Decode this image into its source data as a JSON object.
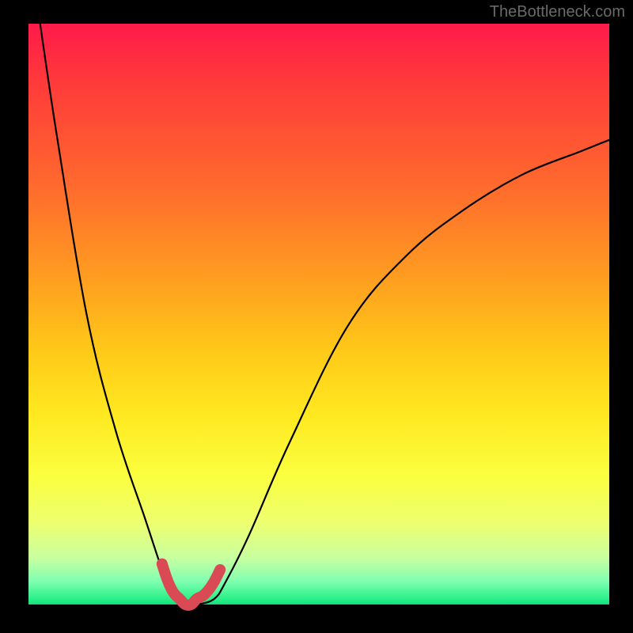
{
  "watermark": "TheBottleneck.com",
  "chart_data": {
    "type": "line",
    "title": "",
    "xlabel": "",
    "ylabel": "",
    "xlim": [
      0,
      100
    ],
    "ylim": [
      0,
      100
    ],
    "grid": false,
    "series": [
      {
        "name": "bottleneck-curve",
        "x": [
          2,
          5,
          10,
          15,
          20,
          23,
          25,
          27,
          29,
          32,
          34,
          38,
          45,
          55,
          65,
          75,
          85,
          95,
          100
        ],
        "y": [
          100,
          80,
          50,
          30,
          15,
          6,
          1,
          0,
          0,
          1,
          4,
          12,
          28,
          48,
          60,
          68,
          74,
          78,
          80
        ]
      }
    ],
    "highlight": {
      "name": "minimum-band",
      "x": [
        23,
        24,
        25,
        26,
        27,
        28,
        29,
        30,
        31,
        32,
        33
      ],
      "y": [
        7,
        4,
        2,
        1,
        0,
        0,
        1,
        1.5,
        2.5,
        4,
        6
      ]
    },
    "gradient_stops": [
      {
        "pos": 0.0,
        "color": "#ff1a4a"
      },
      {
        "pos": 0.28,
        "color": "#ff6a2d"
      },
      {
        "pos": 0.56,
        "color": "#ffc818"
      },
      {
        "pos": 0.78,
        "color": "#faff3f"
      },
      {
        "pos": 0.96,
        "color": "#80ffb0"
      },
      {
        "pos": 1.0,
        "color": "#10e079"
      }
    ]
  }
}
